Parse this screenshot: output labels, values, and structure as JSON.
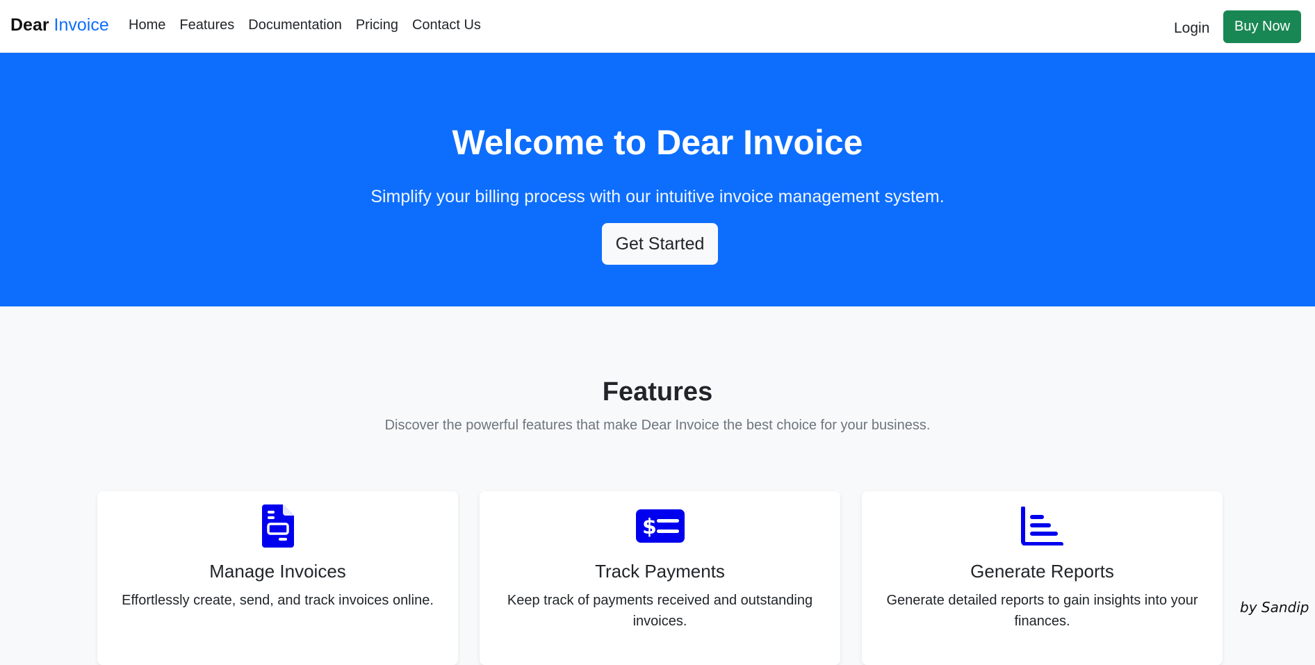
{
  "navbar": {
    "brand_bold": "Dear",
    "brand_accent": "Invoice",
    "links": [
      "Home",
      "Features",
      "Documentation",
      "Pricing",
      "Contact Us"
    ],
    "login_label": "Login",
    "buy_label": "Buy Now"
  },
  "hero": {
    "title": "Welcome to Dear Invoice",
    "subtitle": "Simplify your billing process with our intuitive invoice management system.",
    "cta_label": "Get Started"
  },
  "features": {
    "title": "Features",
    "subtitle": "Discover the powerful features that make Dear Invoice the best choice for your business.",
    "cards": [
      {
        "icon": "invoice-document-icon",
        "title": "Manage Invoices",
        "text": "Effortlessly create, send, and track invoices online."
      },
      {
        "icon": "cash-payment-icon",
        "title": "Track Payments",
        "text": "Keep track of payments received and outstanding invoices."
      },
      {
        "icon": "bar-chart-icon",
        "title": "Generate Reports",
        "text": "Generate detailed reports to gain insights into your finances."
      }
    ]
  },
  "signature": "by Sandip",
  "colors": {
    "primary": "#0d6efd",
    "success": "#198754",
    "icon": "#0000ee",
    "background": "#f8f9fa"
  }
}
